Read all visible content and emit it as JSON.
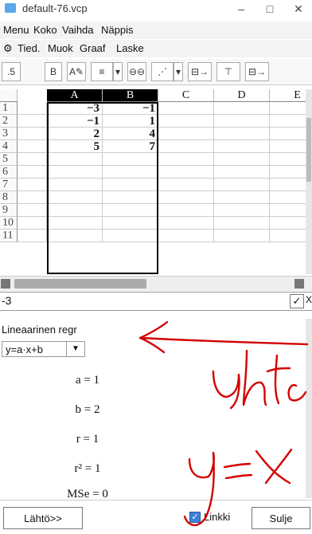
{
  "window": {
    "title": "default-76.vcp",
    "minimize_icon": "minimize-icon",
    "maximize_icon": "maximize-icon",
    "close_icon": "close-icon"
  },
  "menubar": {
    "items": [
      "Menu",
      "Koko",
      "Vaihda",
      "Näppis"
    ]
  },
  "commandbar": {
    "gear_icon": "gear-icon",
    "items": [
      "Tied.",
      "Muok",
      "Graaf",
      "Laske"
    ]
  },
  "toolbar": {
    "bold_label": "B"
  },
  "sheet": {
    "columns": [
      "A",
      "B",
      "C",
      "D",
      "E"
    ],
    "row_numbers": [
      "1",
      "2",
      "3",
      "4",
      "5",
      "6",
      "7",
      "8",
      "9",
      "10",
      "11"
    ],
    "cells": [
      [
        "−3",
        "−1"
      ],
      [
        "−1",
        "1"
      ],
      [
        "2",
        "4"
      ],
      [
        "5",
        "7"
      ]
    ]
  },
  "entry": {
    "value": "-3",
    "ok_label": "✓",
    "close_label": "X"
  },
  "results": {
    "title": "Lineaarinen regr",
    "model": "y=a·x+b",
    "params": [
      "a = 1",
      "b = 2",
      "r = 1",
      "r² = 1",
      "MSe = 0"
    ]
  },
  "bottom": {
    "back_label": "Lähtö>>",
    "link_label": "Linkki",
    "link_checked": true,
    "close_label": "Sulje"
  },
  "colors": {
    "ink": "#d40000",
    "checkbox": "#3b82d6"
  }
}
